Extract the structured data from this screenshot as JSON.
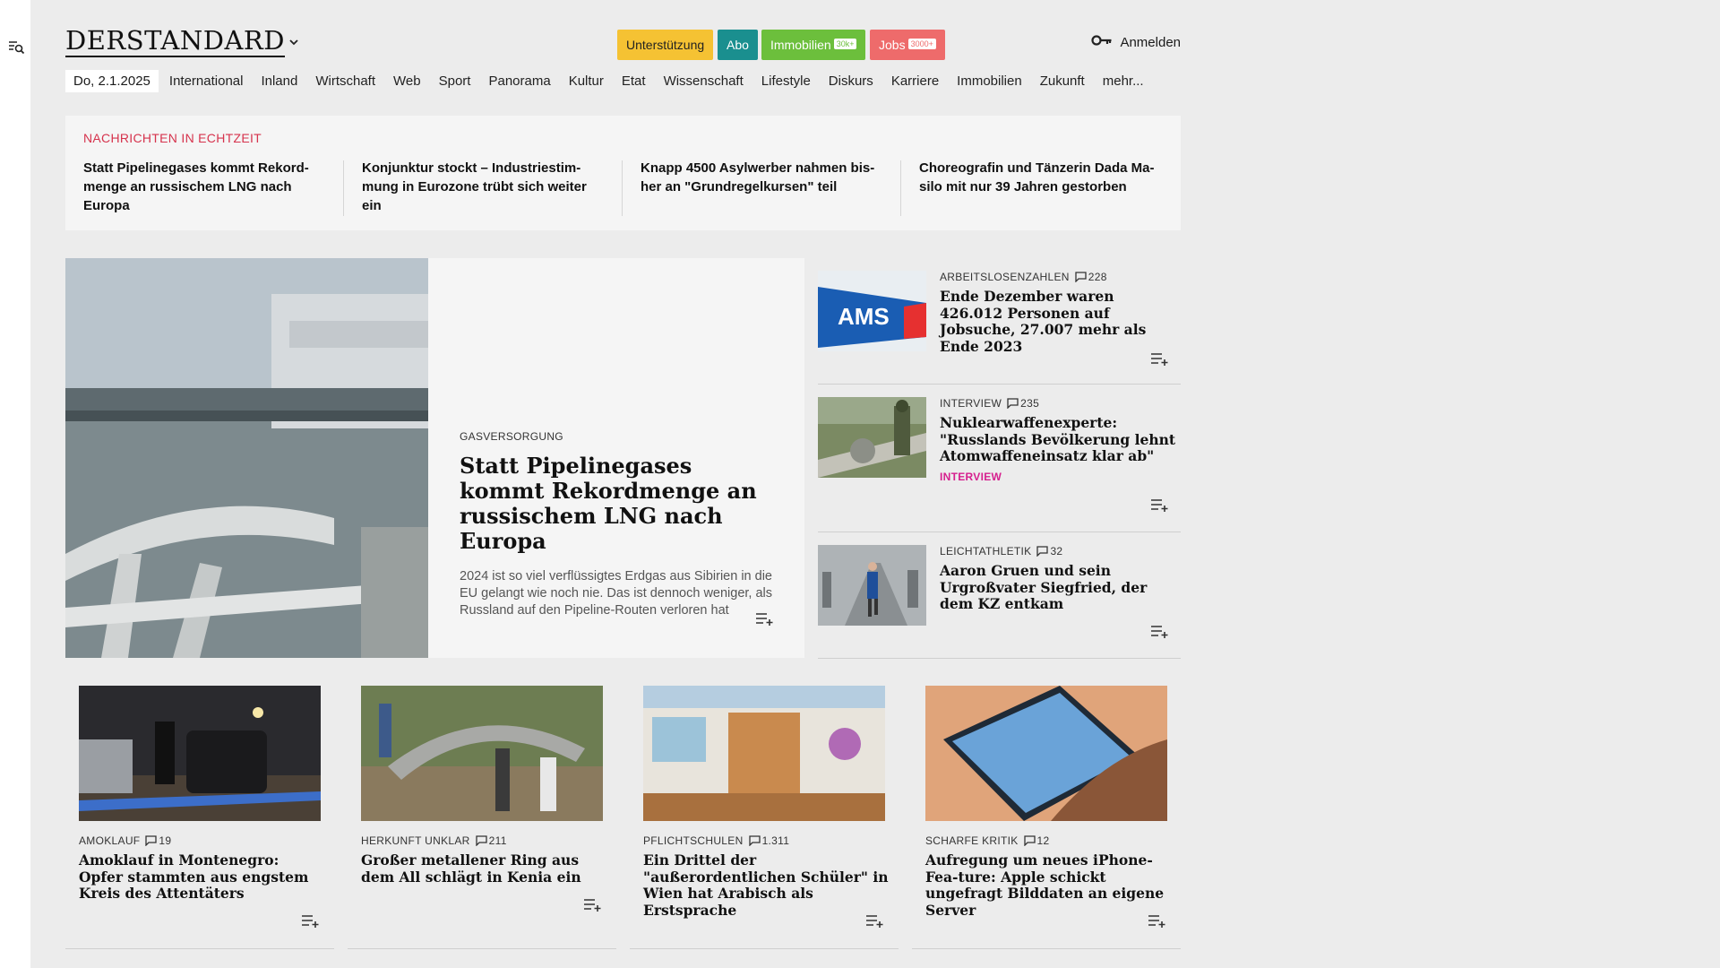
{
  "masthead": {
    "logo": "DERSTANDARD",
    "promos": [
      {
        "label": "Unterstützung",
        "badge": ""
      },
      {
        "label": "Abo",
        "badge": ""
      },
      {
        "label": "Immobilien",
        "badge": "30k+"
      },
      {
        "label": "Jobs",
        "badge": "3000+"
      }
    ],
    "login_label": "Anmelden"
  },
  "nav": {
    "date": "Do, 2.1.2025",
    "items": [
      "International",
      "Inland",
      "Wirtschaft",
      "Web",
      "Sport",
      "Panorama",
      "Kultur",
      "Etat",
      "Wissenschaft",
      "Lifestyle",
      "Diskurs",
      "Karriere",
      "Immobilien",
      "Zukunft",
      "mehr..."
    ]
  },
  "ticker": {
    "label": "NACHRICHTEN IN ECHTZEIT",
    "items": [
      "Statt Pipelinegases kommt Rekord-menge an russischem LNG nach Europa",
      "Konjunktur stockt – Industriestim-mung in Eurozone trübt sich weiter ein",
      "Knapp 4500 Asylwerber nahmen bis-her an \"Grundregelkursen\" teil",
      "Choreografin und Tänzerin Dada Ma-silo mit nur 39 Jahren gestorben"
    ]
  },
  "lead": {
    "kicker": "GASVERSORGUNG",
    "title": "Statt Pipelinegases kommt Rekordmenge an russischem LNG nach Europa",
    "teaser": "2024 ist so viel verflüssigtes Erdgas aus Sibirien in die EU gelangt wie noch nie. Das ist dennoch weniger, als Russland auf den Pipeline-Routen verloren hat"
  },
  "side": [
    {
      "kicker": "ARBEITSLOSENZAHLEN",
      "comments": "228",
      "title": "Ende Dezember waren 426.012 Personen auf Jobsuche, 27.007 mehr als Ende 2023",
      "tag": "",
      "img_text": "AMS"
    },
    {
      "kicker": "INTERVIEW",
      "comments": "235",
      "title": "Nuklearwaffenexperte: \"Russlands Bevölkerung lehnt Atomwaffeneinsatz klar ab\"",
      "tag": "INTERVIEW",
      "img_text": ""
    },
    {
      "kicker": "LEICHTATHLETIK",
      "comments": "32",
      "title": "Aaron Gruen und sein Urgroßvater Siegfried, der dem KZ entkam",
      "tag": "",
      "img_text": ""
    }
  ],
  "cards": [
    {
      "kicker": "AMOKLAUF",
      "comments": "19",
      "title": "Amoklauf in Montenegro: Opfer stammten aus engstem Kreis des Attentäters"
    },
    {
      "kicker": "HERKUNFT UNKLAR",
      "comments": "211",
      "title": "Großer metallener Ring aus dem All schlägt in Kenia ein"
    },
    {
      "kicker": "PFLICHTSCHULEN",
      "comments": "1.311",
      "title": "Ein Drittel der \"außerordentlichen Schüler\" in Wien hat Arabisch als Erstsprache"
    },
    {
      "kicker": "SCHARFE KRITIK",
      "comments": "12",
      "title": "Aufregung um neues iPhone-Fea-ture: Apple schickt ungefragt Bilddaten an eigene Server"
    }
  ]
}
